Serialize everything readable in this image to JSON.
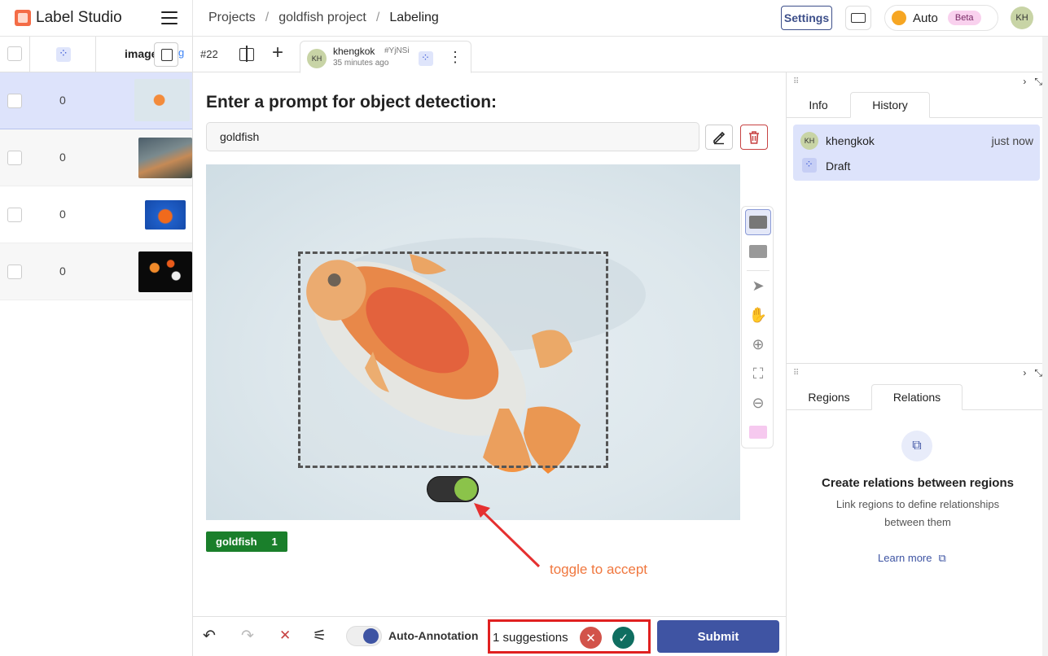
{
  "app": {
    "name": "Label Studio"
  },
  "breadcrumb": [
    "Projects",
    "/",
    "goldfish project",
    "/",
    "Labeling"
  ],
  "header": {
    "settings_label": "Settings",
    "mode_label": "Auto",
    "beta_label": "Beta",
    "user_initials": "KH"
  },
  "task_list": {
    "column_image": "image",
    "rows": [
      {
        "value": "0",
        "selected": true
      },
      {
        "value": "0",
        "selected": false
      },
      {
        "value": "0",
        "selected": false
      },
      {
        "value": "0",
        "selected": false
      }
    ]
  },
  "annotation_tabs": {
    "task_id": "#22",
    "annotation": {
      "initials": "KH",
      "user": "khengkok",
      "hash": "#YjNSi",
      "time": "35 minutes ago"
    }
  },
  "main": {
    "prompt_title": "Enter a prompt for object detection:",
    "prompt_value": "goldfish",
    "label_chip": {
      "name": "goldfish",
      "count": "1"
    },
    "callout_text": "toggle to accept"
  },
  "bottom": {
    "auto_annotation_label": "Auto-Annotation",
    "suggestions_text": "1 suggestions",
    "submit_label": "Submit"
  },
  "right_panel": {
    "top_tabs": [
      "Info",
      "History"
    ],
    "history": {
      "initials": "KH",
      "user": "khengkok",
      "time": "just now",
      "status": "Draft"
    },
    "bottom_tabs": [
      "Regions",
      "Relations"
    ],
    "relations_empty": {
      "title": "Create relations between regions",
      "description": "Link regions to define relationships between them",
      "link": "Learn more"
    }
  },
  "colors": {
    "accent": "#3f54a3",
    "label_green": "#1a7f2b",
    "highlight_red": "#e02020",
    "callout_orange": "#f0773e"
  }
}
